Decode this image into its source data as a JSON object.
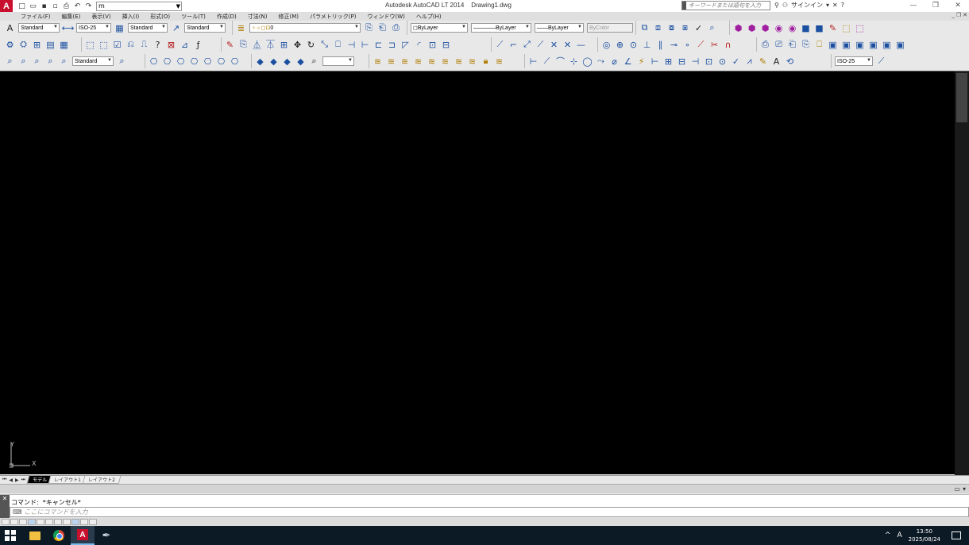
{
  "window": {
    "app_logo": "A",
    "title": "Autodesk AutoCAD LT 2014    Drawing1.dwg",
    "workspace_value": "m",
    "search_placeholder": "キーワードまたは語句を入力",
    "signin_label": "サインイン",
    "help_label": "?"
  },
  "menu": [
    "ファイル(F)",
    "編集(E)",
    "表示(V)",
    "挿入(I)",
    "形式(O)",
    "ツール(T)",
    "作成(D)",
    "寸法(N)",
    "修正(M)",
    "パラメトリック(P)",
    "ウィンドウ(W)",
    "ヘルプ(H)"
  ],
  "toolbar_styles": {
    "text_style": "Standard",
    "dim_style": "ISO-25",
    "table_style": "Standard",
    "mleader_style": "Standard"
  },
  "layers": {
    "current_layer": "0",
    "color": "ByLayer",
    "linetype": "ByLayer",
    "lineweight": "ByLayer",
    "plotstyle": "ByColor"
  },
  "row3": {
    "visual_style": "Standard",
    "dim_style_right": "ISO-25"
  },
  "canvas": {
    "background": "#000000",
    "ucs_x_label": "X",
    "ucs_y_label": "Y"
  },
  "layout_tabs": {
    "model": "モデル",
    "layout1": "レイアウト1",
    "layout2": "レイアウト2"
  },
  "command": {
    "history": "コマンド:  *キャンセル*",
    "placeholder": "ここにコマンドを入力"
  },
  "taskbar": {
    "time": "13:50",
    "date": "2025/08/24",
    "ime": "A",
    "tray_chevron": "^"
  },
  "colors": {
    "accent": "#c8102e",
    "canvas": "#000000",
    "taskbar": "#0c1a26",
    "active_tab_indicator": "#76b9ed"
  }
}
